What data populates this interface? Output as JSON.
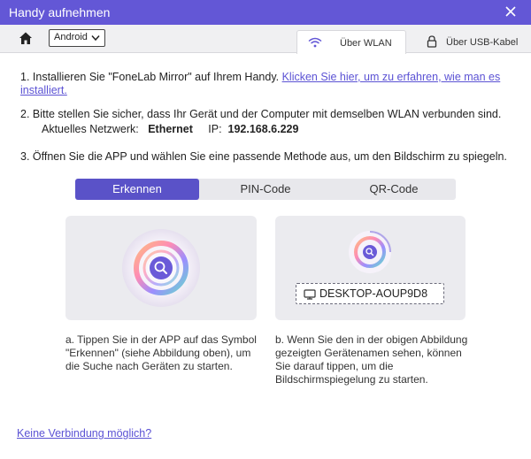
{
  "window": {
    "title": "Handy aufnehmen"
  },
  "toolbar": {
    "os_select": {
      "value": "Android"
    },
    "tabs": [
      {
        "label": "Über WLAN",
        "icon": "wifi-icon",
        "active": true
      },
      {
        "label": "Über USB-Kabel",
        "icon": "lock-icon",
        "active": false
      }
    ]
  },
  "instructions": {
    "step1_text": "1. Installieren Sie \"FoneLab Mirror\" auf Ihrem Handy. ",
    "step1_link": "Klicken Sie hier, um zu erfahren, wie man es installiert.",
    "step2_text": "2. Bitte stellen Sie sicher, dass Ihr Gerät und der Computer mit demselben WLAN verbunden sind.",
    "network_label": "Aktuelles Netzwerk:",
    "network_value": "Ethernet",
    "ip_label": "IP:",
    "ip_value": "192.168.6.229",
    "step3_text": "3. Öffnen Sie die APP und wählen Sie eine passende Methode aus, um den Bildschirm zu spiegeln."
  },
  "method_tabs": [
    {
      "label": "Erkennen",
      "active": true
    },
    {
      "label": "PIN-Code",
      "active": false
    },
    {
      "label": "QR-Code",
      "active": false
    }
  ],
  "device": {
    "name": "DESKTOP-AOUP9D8",
    "icon": "monitor-icon"
  },
  "descriptions": {
    "left": "a. Tippen Sie in der APP auf das Symbol \"Erkennen\" (siehe Abbildung oben), um die Suche nach Geräten zu starten.",
    "right": "b. Wenn Sie den in der obigen Abbildung gezeigten Gerätenamen sehen, können Sie darauf tippen, um die Bildschirmspiegelung zu starten."
  },
  "footer": {
    "link": "Keine Verbindung möglich?"
  },
  "colors": {
    "titlebar": "#6357d6",
    "accent": "#5a52c8",
    "link": "#5b52d4",
    "card": "#ebebef"
  }
}
